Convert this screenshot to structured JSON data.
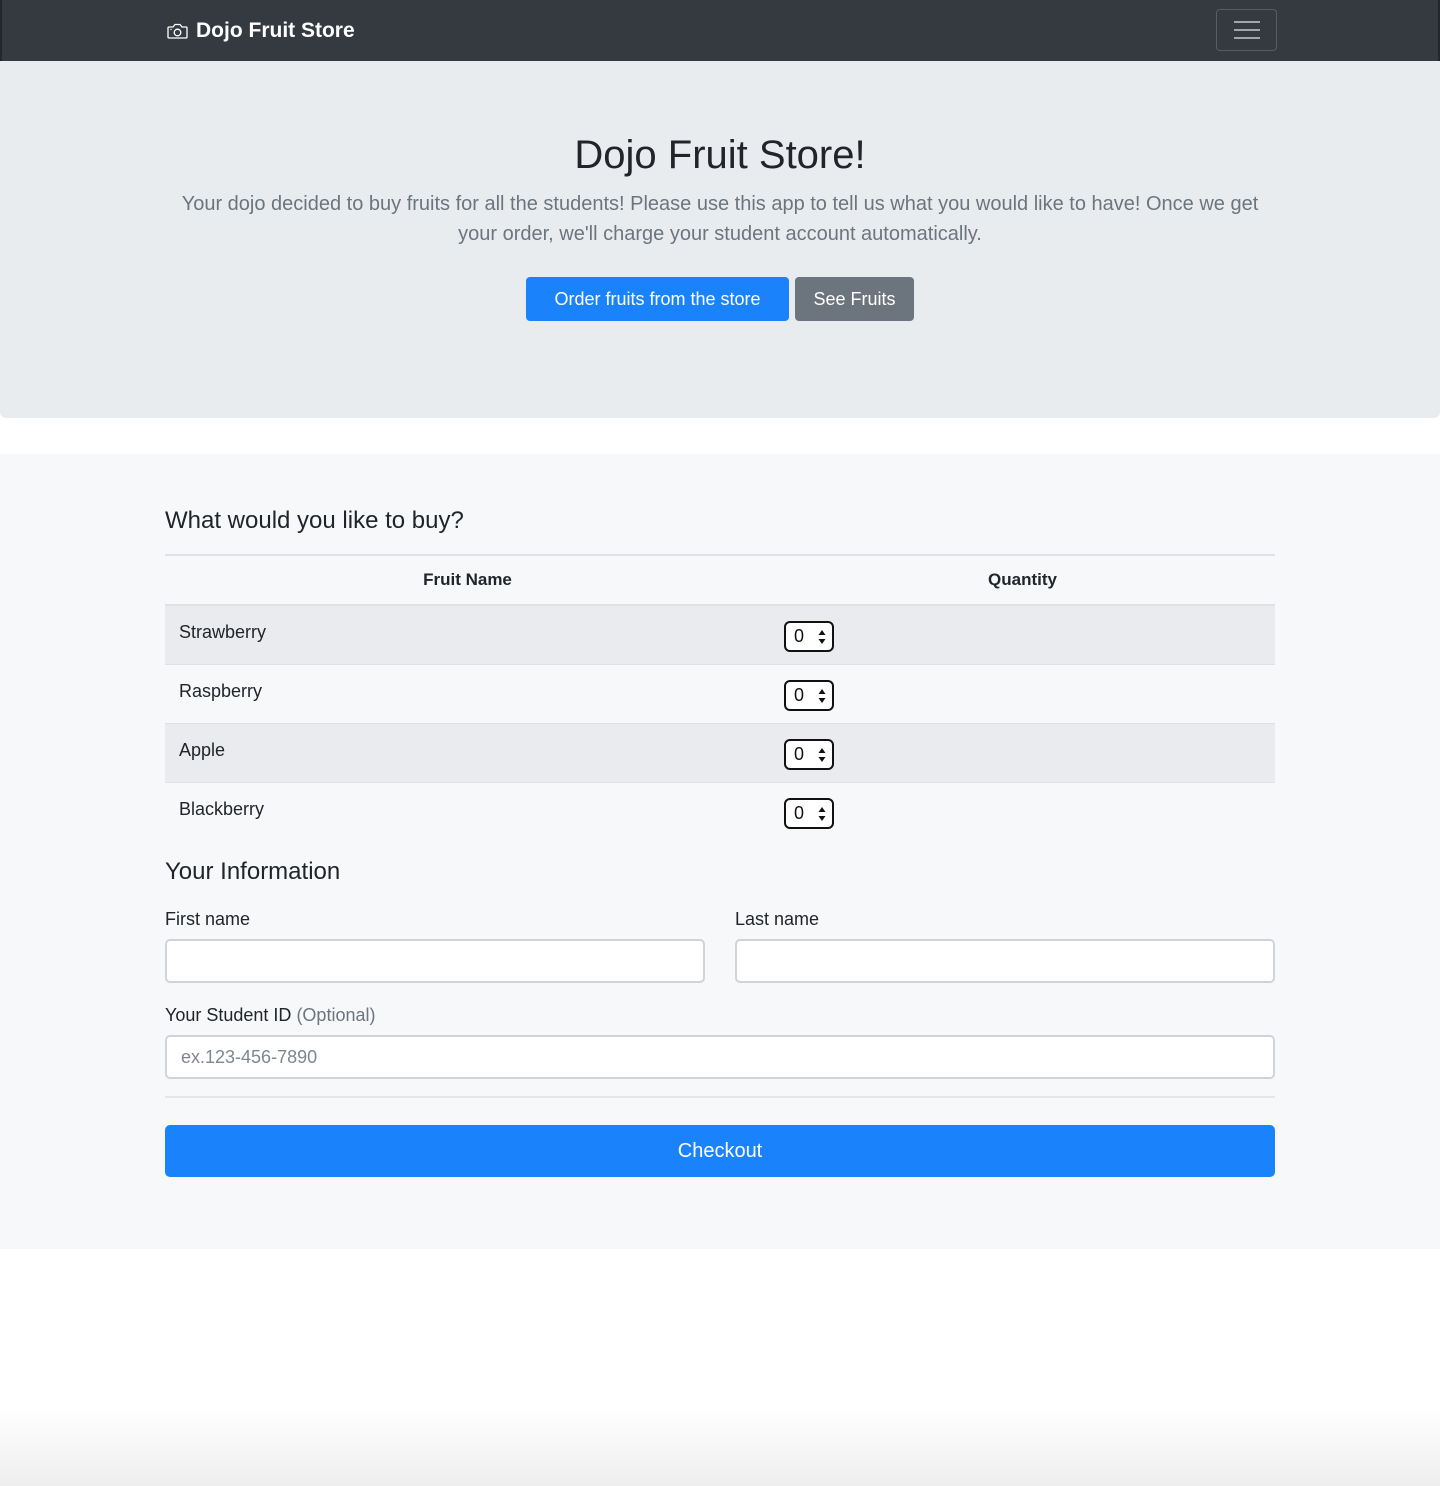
{
  "navbar": {
    "brand": "Dojo Fruit Store",
    "brand_icon": "camera-icon",
    "toggler_icon": "hamburger-menu-icon"
  },
  "hero": {
    "title": "Dojo Fruit Store!",
    "lead": "Your dojo decided to buy fruits for all the students! Please use this app to tell us what you would like to have! Once we get your order, we'll charge your student account automatically.",
    "primary_button": "Order fruits from the store",
    "secondary_button": "See Fruits"
  },
  "order": {
    "title": "What would you like to buy?",
    "columns": {
      "name": "Fruit Name",
      "quantity": "Quantity"
    },
    "rows": [
      {
        "name": "Strawberry",
        "quantity": "0"
      },
      {
        "name": "Raspberry",
        "quantity": "0"
      },
      {
        "name": "Apple",
        "quantity": "0"
      },
      {
        "name": "Blackberry",
        "quantity": "0"
      }
    ]
  },
  "info": {
    "title": "Your Information",
    "first_name_label": "First name",
    "first_name_value": "",
    "last_name_label": "Last name",
    "last_name_value": "",
    "student_id_label": "Your Student ID",
    "student_id_optional": "(Optional)",
    "student_id_placeholder": "ex.123-456-7890",
    "student_id_value": ""
  },
  "checkout_button": "Checkout",
  "colors": {
    "navbar": "#343a40",
    "hero_bg": "#e9ecef",
    "primary": "#1a82fb",
    "secondary": "#6c757d",
    "section_bg": "#f7f8fa"
  }
}
